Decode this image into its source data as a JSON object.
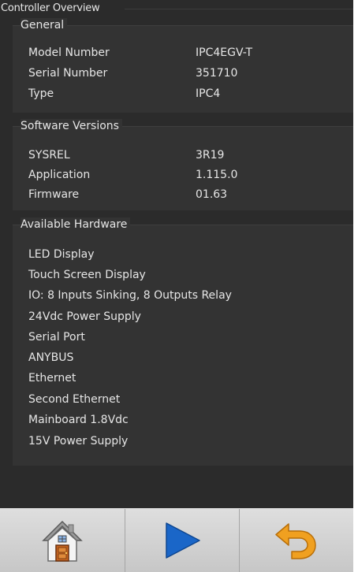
{
  "screen": {
    "title": "Controller Overview"
  },
  "general": {
    "heading": "General",
    "rows": [
      {
        "label": "Model Number",
        "value": "IPC4EGV-T"
      },
      {
        "label": "Serial Number",
        "value": "351710"
      },
      {
        "label": "Type",
        "value": "IPC4"
      }
    ]
  },
  "software": {
    "heading": "Software Versions",
    "rows": [
      {
        "label": "SYSREL",
        "value": "3R19"
      },
      {
        "label": "Application",
        "value": "1.115.0"
      },
      {
        "label": "Firmware",
        "value": "01.63"
      }
    ]
  },
  "hardware": {
    "heading": "Available Hardware",
    "items": [
      "LED Display",
      "Touch Screen Display",
      "IO: 8 Inputs Sinking, 8 Outputs Relay",
      "24Vdc Power Supply",
      "Serial Port",
      "ANYBUS",
      "Ethernet",
      "Second Ethernet",
      "Mainboard 1.8Vdc",
      "15V Power Supply"
    ]
  },
  "footer": {
    "buttons": [
      {
        "icon": "home-icon"
      },
      {
        "icon": "play-icon"
      },
      {
        "icon": "undo-icon"
      }
    ]
  },
  "colors": {
    "background": "#2b2b2b",
    "panel": "#333333",
    "text": "#e6e6e6",
    "play_blue": "#1a66c8",
    "undo_orange": "#f0a020",
    "footer": "#d0d0d0"
  }
}
